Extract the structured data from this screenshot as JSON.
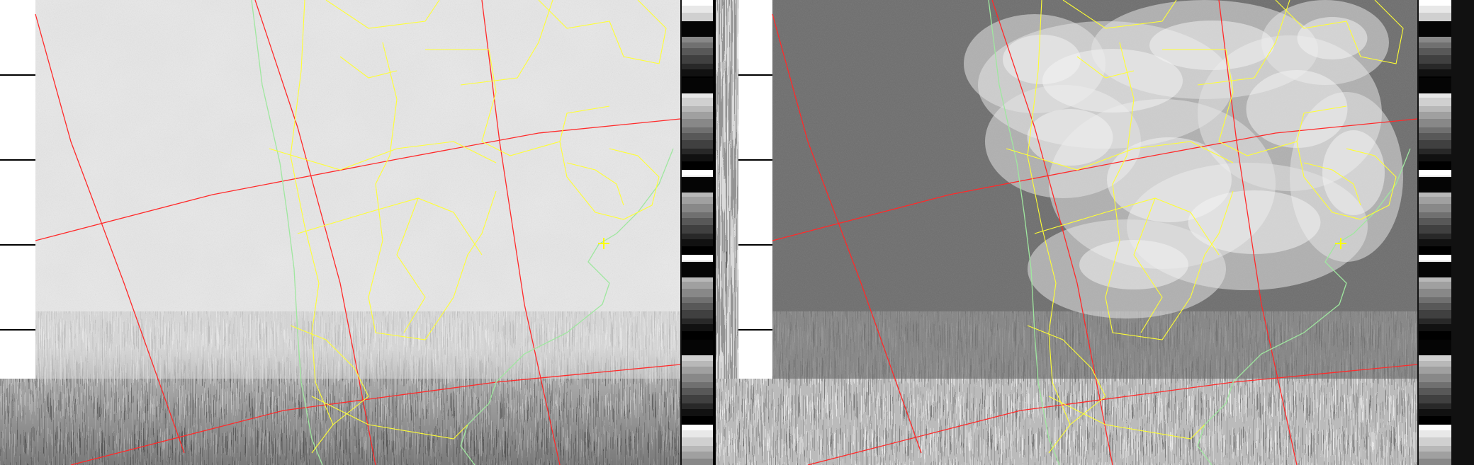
{
  "image": {
    "kind": "NOAA APT satellite weather image, dual channel",
    "channels": [
      {
        "name": "channel-a",
        "tone": "light"
      },
      {
        "name": "channel-b",
        "tone": "dark"
      }
    ],
    "overlay_colors": {
      "graticule": "#ff2a2a",
      "borders": "#ffff33",
      "coastline": "#9fe79f",
      "marker": "#ffff00"
    }
  }
}
